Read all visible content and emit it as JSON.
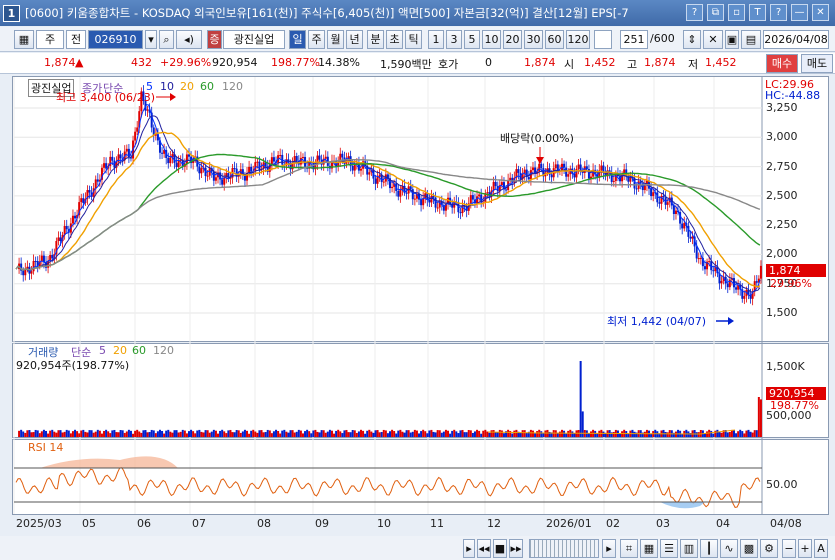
{
  "window": {
    "number": "1",
    "title": "[0600] 키움종합차트 - KOSDAQ 외국인보유[161(천)] 주식수[6,405(천)] 액면[500] 자본금[32(억)] 결산[12월] EPS[-7",
    "buttons": [
      "?",
      "⧉",
      "▫",
      "T",
      "?",
      "—",
      "✕"
    ]
  },
  "toolbar": {
    "market": "주",
    "prev": "전",
    "code": "026910",
    "stock_name": "광진실업",
    "periods": [
      "일",
      "주",
      "월",
      "년",
      "분",
      "초",
      "틱"
    ],
    "multipliers": [
      "1",
      "3",
      "5",
      "10",
      "20",
      "30",
      "60",
      "120"
    ],
    "count": "251",
    "total": "/600",
    "date": "2026/04/08"
  },
  "info": {
    "price": "1,874",
    "change": "432",
    "change_pct": "+29.96%",
    "volume": "920,954",
    "vol_ratio": "198.77%",
    "turnover": "14.38%",
    "amount": "1,590백만",
    "hoga_label": "호가",
    "hoga": "0",
    "ask": "1,874",
    "open_label": "시",
    "open": "1,452",
    "high_label": "고",
    "high": "1,874",
    "low_label": "저",
    "low": "1,452",
    "buy": "매수",
    "sell": "매도"
  },
  "price_pane": {
    "legend": [
      "광진실업",
      "종가",
      "단순",
      "5",
      "10",
      "20",
      "60",
      "120"
    ],
    "lc": "LC:29.96",
    "hc": "HC:-44.88",
    "high_note": "최고 3,400 (06/23)",
    "low_note": "최저 1,442 (04/07)",
    "div_note": "배당락(0.00%)",
    "last": "1,874",
    "last_pct": "29.96%",
    "y_ticks": [
      "3,250",
      "3,000",
      "2,750",
      "2,500",
      "2,250",
      "2,000",
      "1,750",
      "1,500"
    ]
  },
  "volume_pane": {
    "legend": [
      "거래량",
      "단순",
      "5",
      "20",
      "60",
      "120"
    ],
    "value": "920,954주(198.77%)",
    "y_ticks": [
      "1,500K",
      "1,000K",
      "500,000"
    ],
    "last": "920,954",
    "last_pct": "198.77%"
  },
  "rsi_pane": {
    "legend": "RSI 14",
    "y_tick": "50.00"
  },
  "x_labels": [
    "2025/03",
    "05",
    "06",
    "07",
    "08",
    "09",
    "10",
    "11",
    "12",
    "2026/01",
    "02",
    "03",
    "04",
    "04/08"
  ],
  "colors": {
    "up": "#e00000",
    "down": "#0020d0",
    "ma5": "#0030ff",
    "ma10": "#2020a0",
    "ma20": "#f0a000",
    "ma60": "#2a9a2a",
    "ma120": "#888888"
  }
}
